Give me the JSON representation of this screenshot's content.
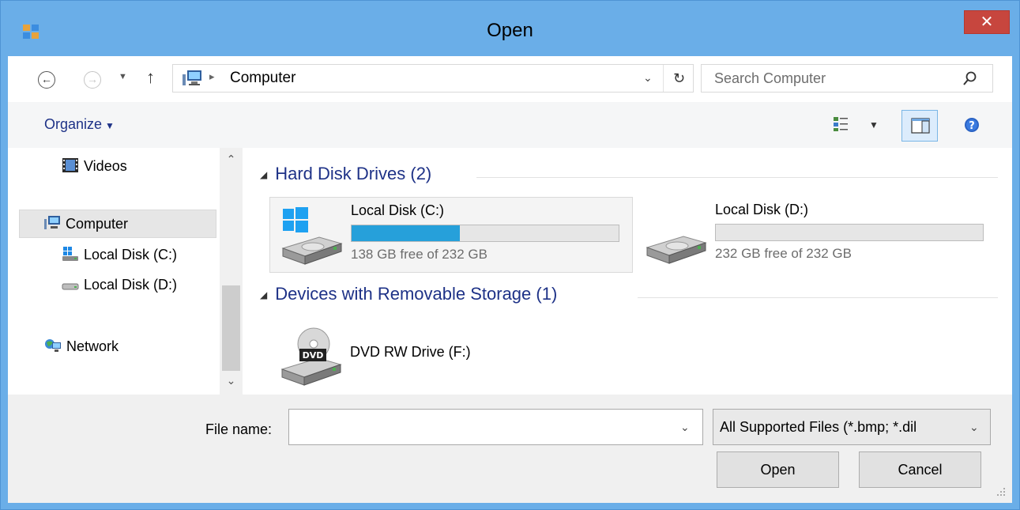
{
  "window": {
    "title": "Open",
    "close_glyph": "✕"
  },
  "address": {
    "back_glyph": "←",
    "forward_glyph": "→",
    "recent_glyph": "▼",
    "up_glyph": "↑",
    "separator_glyph": "▸",
    "location": "Computer",
    "dropdown_glyph": "⌄",
    "refresh_glyph": "↻"
  },
  "search": {
    "placeholder": "Search Computer"
  },
  "toolbar": {
    "organize_label": "Organize",
    "organize_caret": "▼",
    "view_caret": "▼"
  },
  "nav_pane": {
    "items": [
      {
        "label": "Videos",
        "icon": "videos-icon"
      },
      {
        "label": "Computer",
        "icon": "computer-icon",
        "selected": true
      },
      {
        "label": "Local Disk (C:)",
        "icon": "system-drive-icon"
      },
      {
        "label": "Local Disk (D:)",
        "icon": "drive-icon"
      },
      {
        "label": "Network",
        "icon": "network-icon"
      }
    ],
    "scroll_up": "⌃",
    "scroll_down": "⌄"
  },
  "content": {
    "groups": [
      {
        "header": "Hard Disk Drives (2)",
        "collapse_glyph": "◢"
      },
      {
        "header": "Devices with Removable Storage (1)",
        "collapse_glyph": "◢"
      }
    ],
    "drives": [
      {
        "name": "Local Disk (C:)",
        "free_text": "138 GB free of 232 GB",
        "used_fraction": 0.405,
        "icon": "windows-drive-icon",
        "selected": true
      },
      {
        "name": "Local Disk (D:)",
        "free_text": "232 GB free of 232 GB",
        "used_fraction": 0.0,
        "icon": "hard-drive-icon"
      }
    ],
    "removable": [
      {
        "name": "DVD RW Drive (F:)",
        "icon": "dvd-drive-icon",
        "badge": "DVD"
      }
    ]
  },
  "bottom": {
    "file_name_label": "File name:",
    "file_name_value": "",
    "file_name_caret": "⌄",
    "filter_value": "All Supported Files (*.bmp; *.dil",
    "filter_caret": "⌄",
    "open_label": "Open",
    "cancel_label": "Cancel"
  },
  "colors": {
    "title_bar": "#6aaee8",
    "close_button": "#c7463e",
    "usage_bar": "#26a0da",
    "group_header": "#1e3287"
  }
}
